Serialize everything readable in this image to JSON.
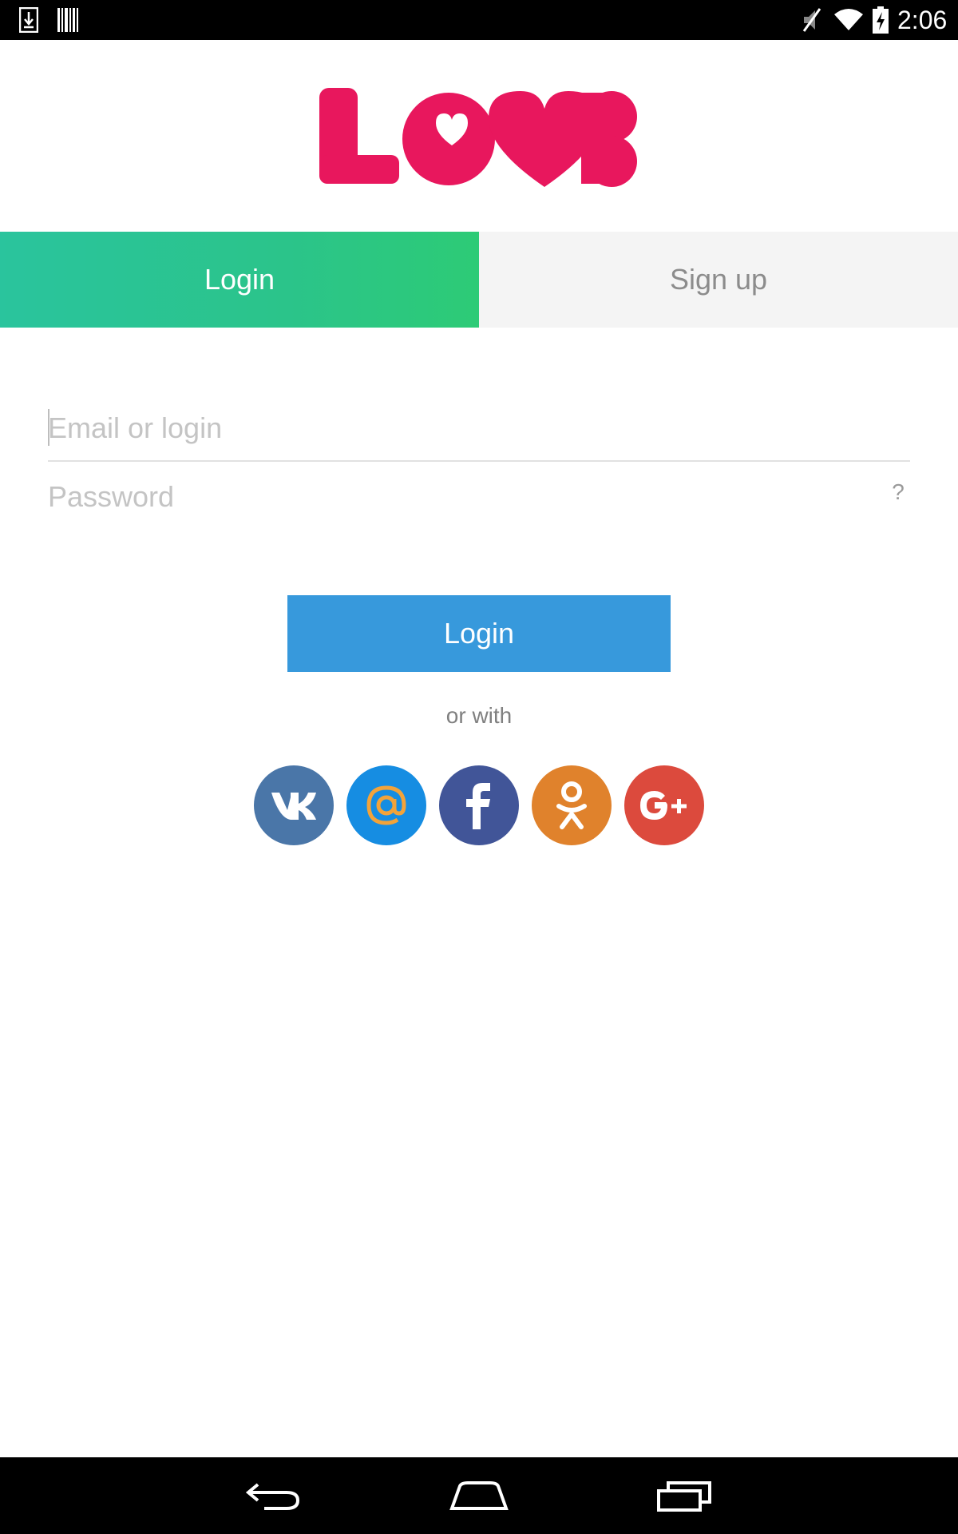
{
  "status_bar": {
    "time": "2:06",
    "icons": [
      "download-icon",
      "barcode-icon",
      "mute-icon",
      "wifi-icon",
      "battery-charging-icon"
    ]
  },
  "logo": {
    "text": "LOVE",
    "color": "#e8175d"
  },
  "tabs": [
    {
      "label": "Login",
      "active": true
    },
    {
      "label": "Sign up",
      "active": false
    }
  ],
  "form": {
    "email": {
      "placeholder": "Email or login",
      "value": ""
    },
    "password": {
      "placeholder": "Password",
      "value": ""
    },
    "forgot_label": "?"
  },
  "login_button": {
    "label": "Login",
    "color": "#3799dc"
  },
  "or_with": "or with",
  "social": [
    {
      "name": "vk-icon",
      "color": "#4a76a8"
    },
    {
      "name": "mail-ru-icon",
      "color": "#168de2"
    },
    {
      "name": "facebook-icon",
      "color": "#415598"
    },
    {
      "name": "odnoklassniki-icon",
      "color": "#e0822c"
    },
    {
      "name": "google-plus-icon",
      "color": "#dc4a3d"
    }
  ],
  "nav_bar": {
    "icons": [
      "back-icon",
      "home-icon",
      "recent-apps-icon"
    ]
  }
}
